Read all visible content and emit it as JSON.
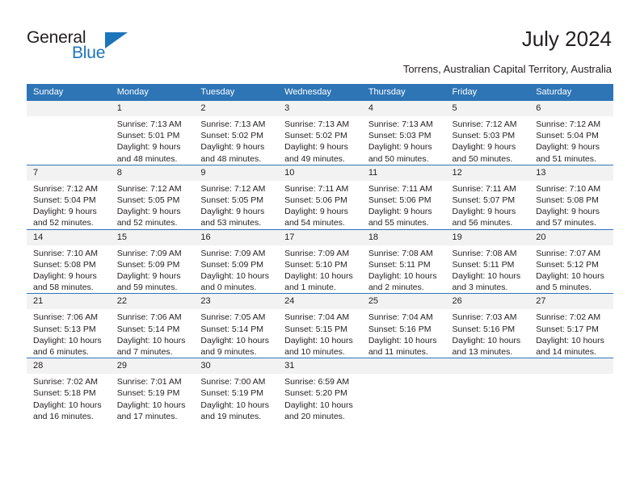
{
  "brand": {
    "name_part1": "General",
    "name_part2": "Blue"
  },
  "header": {
    "title": "July 2024",
    "location": "Torrens, Australian Capital Territory, Australia"
  },
  "colors": {
    "header_blue": "#2e75b6",
    "brand_blue": "#1b75bb",
    "daynum_band": "#f2f2f2",
    "text": "#231f20"
  },
  "weekdays": [
    "Sunday",
    "Monday",
    "Tuesday",
    "Wednesday",
    "Thursday",
    "Friday",
    "Saturday"
  ],
  "weeks": [
    [
      {
        "day": "",
        "sunrise": "",
        "sunset": "",
        "daylight_line1": "",
        "daylight_line2": ""
      },
      {
        "day": "1",
        "sunrise": "Sunrise: 7:13 AM",
        "sunset": "Sunset: 5:01 PM",
        "daylight_line1": "Daylight: 9 hours",
        "daylight_line2": "and 48 minutes."
      },
      {
        "day": "2",
        "sunrise": "Sunrise: 7:13 AM",
        "sunset": "Sunset: 5:02 PM",
        "daylight_line1": "Daylight: 9 hours",
        "daylight_line2": "and 48 minutes."
      },
      {
        "day": "3",
        "sunrise": "Sunrise: 7:13 AM",
        "sunset": "Sunset: 5:02 PM",
        "daylight_line1": "Daylight: 9 hours",
        "daylight_line2": "and 49 minutes."
      },
      {
        "day": "4",
        "sunrise": "Sunrise: 7:13 AM",
        "sunset": "Sunset: 5:03 PM",
        "daylight_line1": "Daylight: 9 hours",
        "daylight_line2": "and 50 minutes."
      },
      {
        "day": "5",
        "sunrise": "Sunrise: 7:12 AM",
        "sunset": "Sunset: 5:03 PM",
        "daylight_line1": "Daylight: 9 hours",
        "daylight_line2": "and 50 minutes."
      },
      {
        "day": "6",
        "sunrise": "Sunrise: 7:12 AM",
        "sunset": "Sunset: 5:04 PM",
        "daylight_line1": "Daylight: 9 hours",
        "daylight_line2": "and 51 minutes."
      }
    ],
    [
      {
        "day": "7",
        "sunrise": "Sunrise: 7:12 AM",
        "sunset": "Sunset: 5:04 PM",
        "daylight_line1": "Daylight: 9 hours",
        "daylight_line2": "and 52 minutes."
      },
      {
        "day": "8",
        "sunrise": "Sunrise: 7:12 AM",
        "sunset": "Sunset: 5:05 PM",
        "daylight_line1": "Daylight: 9 hours",
        "daylight_line2": "and 52 minutes."
      },
      {
        "day": "9",
        "sunrise": "Sunrise: 7:12 AM",
        "sunset": "Sunset: 5:05 PM",
        "daylight_line1": "Daylight: 9 hours",
        "daylight_line2": "and 53 minutes."
      },
      {
        "day": "10",
        "sunrise": "Sunrise: 7:11 AM",
        "sunset": "Sunset: 5:06 PM",
        "daylight_line1": "Daylight: 9 hours",
        "daylight_line2": "and 54 minutes."
      },
      {
        "day": "11",
        "sunrise": "Sunrise: 7:11 AM",
        "sunset": "Sunset: 5:06 PM",
        "daylight_line1": "Daylight: 9 hours",
        "daylight_line2": "and 55 minutes."
      },
      {
        "day": "12",
        "sunrise": "Sunrise: 7:11 AM",
        "sunset": "Sunset: 5:07 PM",
        "daylight_line1": "Daylight: 9 hours",
        "daylight_line2": "and 56 minutes."
      },
      {
        "day": "13",
        "sunrise": "Sunrise: 7:10 AM",
        "sunset": "Sunset: 5:08 PM",
        "daylight_line1": "Daylight: 9 hours",
        "daylight_line2": "and 57 minutes."
      }
    ],
    [
      {
        "day": "14",
        "sunrise": "Sunrise: 7:10 AM",
        "sunset": "Sunset: 5:08 PM",
        "daylight_line1": "Daylight: 9 hours",
        "daylight_line2": "and 58 minutes."
      },
      {
        "day": "15",
        "sunrise": "Sunrise: 7:09 AM",
        "sunset": "Sunset: 5:09 PM",
        "daylight_line1": "Daylight: 9 hours",
        "daylight_line2": "and 59 minutes."
      },
      {
        "day": "16",
        "sunrise": "Sunrise: 7:09 AM",
        "sunset": "Sunset: 5:09 PM",
        "daylight_line1": "Daylight: 10 hours",
        "daylight_line2": "and 0 minutes."
      },
      {
        "day": "17",
        "sunrise": "Sunrise: 7:09 AM",
        "sunset": "Sunset: 5:10 PM",
        "daylight_line1": "Daylight: 10 hours",
        "daylight_line2": "and 1 minute."
      },
      {
        "day": "18",
        "sunrise": "Sunrise: 7:08 AM",
        "sunset": "Sunset: 5:11 PM",
        "daylight_line1": "Daylight: 10 hours",
        "daylight_line2": "and 2 minutes."
      },
      {
        "day": "19",
        "sunrise": "Sunrise: 7:08 AM",
        "sunset": "Sunset: 5:11 PM",
        "daylight_line1": "Daylight: 10 hours",
        "daylight_line2": "and 3 minutes."
      },
      {
        "day": "20",
        "sunrise": "Sunrise: 7:07 AM",
        "sunset": "Sunset: 5:12 PM",
        "daylight_line1": "Daylight: 10 hours",
        "daylight_line2": "and 5 minutes."
      }
    ],
    [
      {
        "day": "21",
        "sunrise": "Sunrise: 7:06 AM",
        "sunset": "Sunset: 5:13 PM",
        "daylight_line1": "Daylight: 10 hours",
        "daylight_line2": "and 6 minutes."
      },
      {
        "day": "22",
        "sunrise": "Sunrise: 7:06 AM",
        "sunset": "Sunset: 5:14 PM",
        "daylight_line1": "Daylight: 10 hours",
        "daylight_line2": "and 7 minutes."
      },
      {
        "day": "23",
        "sunrise": "Sunrise: 7:05 AM",
        "sunset": "Sunset: 5:14 PM",
        "daylight_line1": "Daylight: 10 hours",
        "daylight_line2": "and 9 minutes."
      },
      {
        "day": "24",
        "sunrise": "Sunrise: 7:04 AM",
        "sunset": "Sunset: 5:15 PM",
        "daylight_line1": "Daylight: 10 hours",
        "daylight_line2": "and 10 minutes."
      },
      {
        "day": "25",
        "sunrise": "Sunrise: 7:04 AM",
        "sunset": "Sunset: 5:16 PM",
        "daylight_line1": "Daylight: 10 hours",
        "daylight_line2": "and 11 minutes."
      },
      {
        "day": "26",
        "sunrise": "Sunrise: 7:03 AM",
        "sunset": "Sunset: 5:16 PM",
        "daylight_line1": "Daylight: 10 hours",
        "daylight_line2": "and 13 minutes."
      },
      {
        "day": "27",
        "sunrise": "Sunrise: 7:02 AM",
        "sunset": "Sunset: 5:17 PM",
        "daylight_line1": "Daylight: 10 hours",
        "daylight_line2": "and 14 minutes."
      }
    ],
    [
      {
        "day": "28",
        "sunrise": "Sunrise: 7:02 AM",
        "sunset": "Sunset: 5:18 PM",
        "daylight_line1": "Daylight: 10 hours",
        "daylight_line2": "and 16 minutes."
      },
      {
        "day": "29",
        "sunrise": "Sunrise: 7:01 AM",
        "sunset": "Sunset: 5:19 PM",
        "daylight_line1": "Daylight: 10 hours",
        "daylight_line2": "and 17 minutes."
      },
      {
        "day": "30",
        "sunrise": "Sunrise: 7:00 AM",
        "sunset": "Sunset: 5:19 PM",
        "daylight_line1": "Daylight: 10 hours",
        "daylight_line2": "and 19 minutes."
      },
      {
        "day": "31",
        "sunrise": "Sunrise: 6:59 AM",
        "sunset": "Sunset: 5:20 PM",
        "daylight_line1": "Daylight: 10 hours",
        "daylight_line2": "and 20 minutes."
      },
      {
        "day": "",
        "sunrise": "",
        "sunset": "",
        "daylight_line1": "",
        "daylight_line2": ""
      },
      {
        "day": "",
        "sunrise": "",
        "sunset": "",
        "daylight_line1": "",
        "daylight_line2": ""
      },
      {
        "day": "",
        "sunrise": "",
        "sunset": "",
        "daylight_line1": "",
        "daylight_line2": ""
      }
    ]
  ]
}
